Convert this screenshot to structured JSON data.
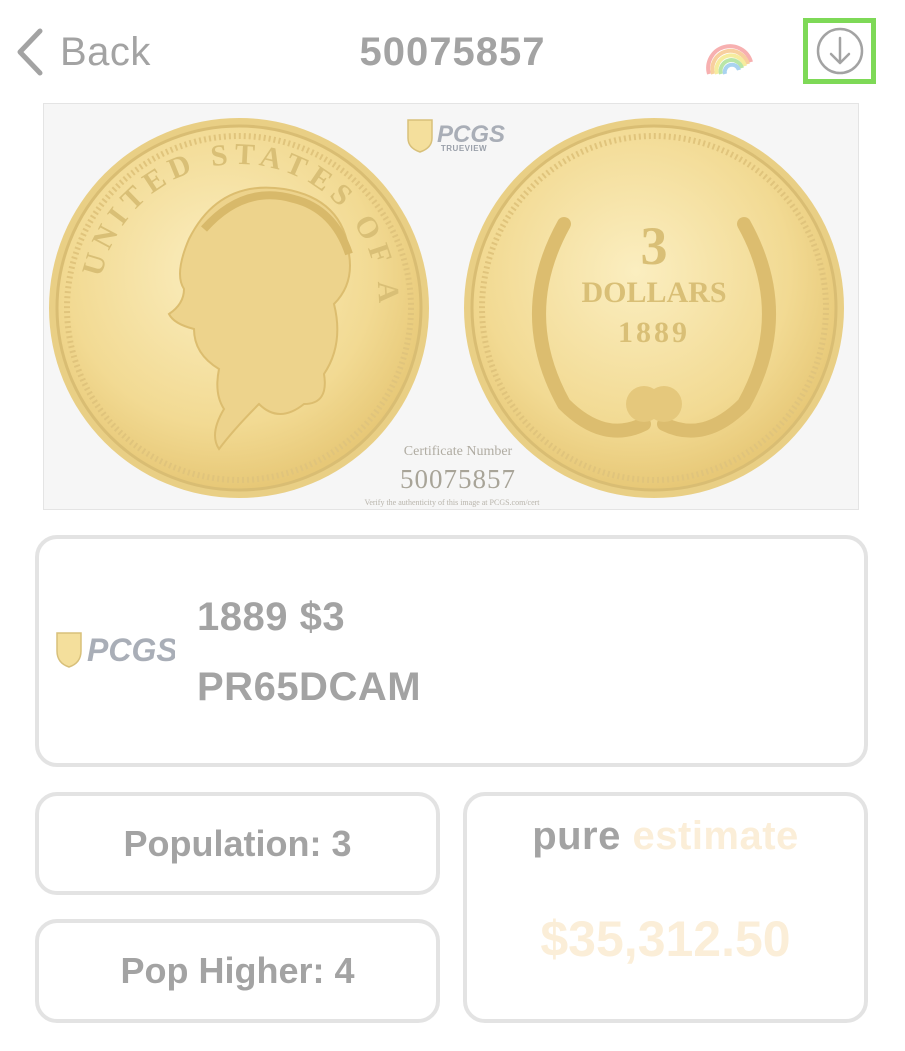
{
  "header": {
    "back_label": "Back",
    "title": "50075857",
    "icons": [
      "chevron-left-icon",
      "rainbow-icon",
      "download-icon"
    ],
    "highlight_color": "#7ed957"
  },
  "coin_image": {
    "brand": "PCGS",
    "brand_sub": "TRUEVIEW",
    "obverse_legend": "UNITED STATES OF AMERICA",
    "reverse_denomination": "3",
    "reverse_unit": "DOLLARS",
    "reverse_year": "1889",
    "cert_label": "Certificate Number",
    "cert_number": "50075857",
    "verify_text": "Verify the authenticity of this image at PCGS.com/cert"
  },
  "grade_card": {
    "brand": "PCGS",
    "line1": "1889 $3",
    "line2": "PR65DCAM"
  },
  "population": {
    "label": "Population: 3"
  },
  "pop_higher": {
    "label": "Pop Higher: 4"
  },
  "estimate": {
    "title_word1": "pure",
    "title_word2": "estimate",
    "value": "$35,312.50",
    "accent_color": "#fbeed8"
  },
  "colors": {
    "text_gray": "#a3a3a3",
    "card_border": "#e3e3e3",
    "gold": "#f3dc9a"
  }
}
